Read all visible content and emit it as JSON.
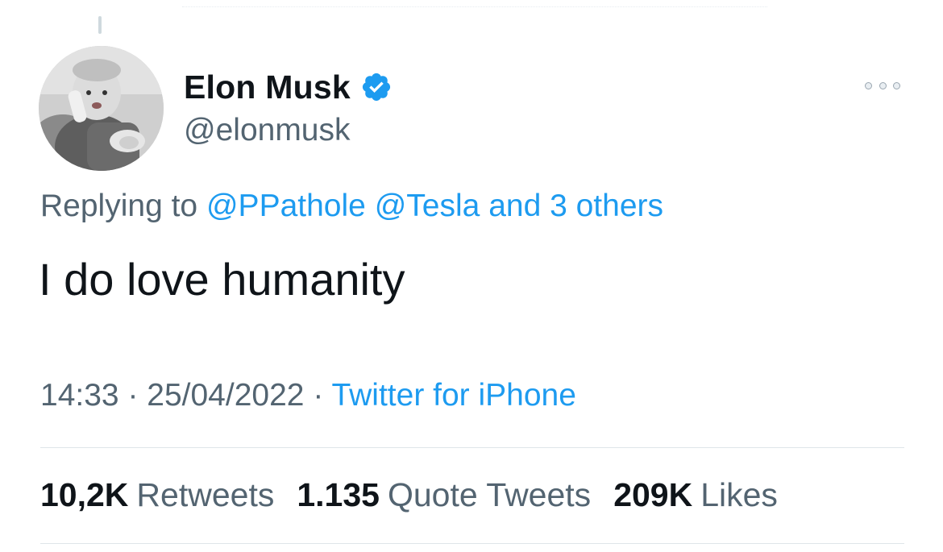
{
  "tweet": {
    "author": {
      "display_name": "Elon Musk",
      "handle": "@elonmusk",
      "verified": true,
      "avatar_icon": "avatar-photo"
    },
    "replying_to": {
      "prefix": "Replying to",
      "user1": "@PPathole",
      "user2": "@Tesla",
      "others": "and 3 others"
    },
    "text": "I do love humanity",
    "time": "14:33",
    "separator1": " · ",
    "date": "25/04/2022",
    "separator2": " · ",
    "source": "Twitter for iPhone",
    "stats": {
      "retweets_count": "10,2K",
      "retweets_label": "Retweets",
      "quotes_count": "1.135",
      "quotes_label": "Quote Tweets",
      "likes_count": "209K",
      "likes_label": "Likes"
    }
  },
  "colors": {
    "link": "#1d9bf0",
    "secondary_text": "#536471",
    "primary_text": "#0f1419",
    "verified_badge": "#1d9bf0"
  }
}
